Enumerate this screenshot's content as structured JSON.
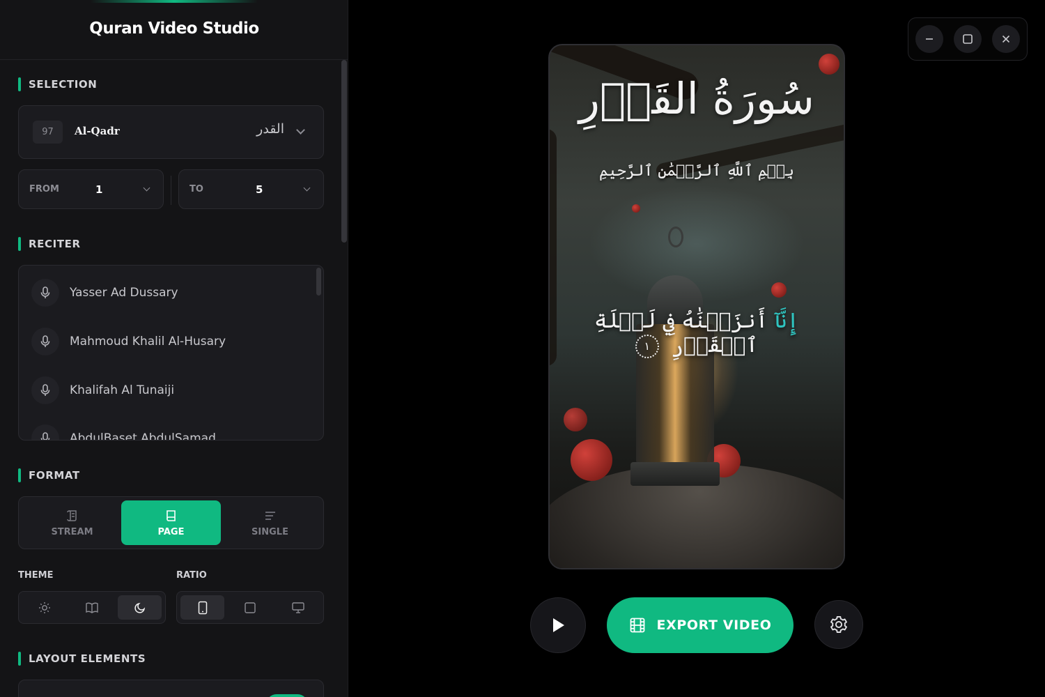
{
  "app": {
    "title": "Quran Video Studio"
  },
  "selection": {
    "label": "SELECTION",
    "surah": {
      "number": "97",
      "name": "Al-Qadr",
      "arabic": "القدر"
    },
    "from": {
      "label": "FROM",
      "value": "1"
    },
    "to": {
      "label": "TO",
      "value": "5"
    }
  },
  "reciter": {
    "label": "RECITER",
    "items": [
      {
        "name": "Yasser Ad Dussary"
      },
      {
        "name": "Mahmoud Khalil Al-Husary"
      },
      {
        "name": "Khalifah Al Tunaiji"
      },
      {
        "name": "AbdulBaset AbdulSamad"
      }
    ]
  },
  "format": {
    "label": "FORMAT",
    "options": [
      {
        "label": "STREAM",
        "icon": "scroll-icon"
      },
      {
        "label": "PAGE",
        "icon": "book-icon",
        "active": true
      },
      {
        "label": "SINGLE",
        "icon": "lines-icon"
      }
    ]
  },
  "theme": {
    "label": "THEME",
    "options": [
      "sun-icon",
      "open-book-icon",
      "moon-icon"
    ],
    "selected": "moon-icon"
  },
  "ratio": {
    "label": "RATIO",
    "options": [
      "phone-icon",
      "square-icon",
      "monitor-icon"
    ],
    "selected": "phone-icon"
  },
  "layout": {
    "label": "LAYOUT ELEMENTS"
  },
  "preview": {
    "surah_title": "سُورَةُ القَدۡرِ",
    "basmala": "بِسۡمِ ٱللَّهِ ٱلرَّحۡمَٰنِ ٱلرَّحِيمِ",
    "ayah_highlight": "إِنَّآ",
    "ayah_rest": "أَنزَلۡنَٰهُ فِي لَيۡلَةِ ٱلۡقَدۡرِ",
    "ayah_number": "١"
  },
  "controls": {
    "export_label": "EXPORT VIDEO"
  },
  "colors": {
    "accent": "#10b981",
    "highlight": "#2fc4c0",
    "background": "#000000",
    "sidebar": "#141416"
  }
}
